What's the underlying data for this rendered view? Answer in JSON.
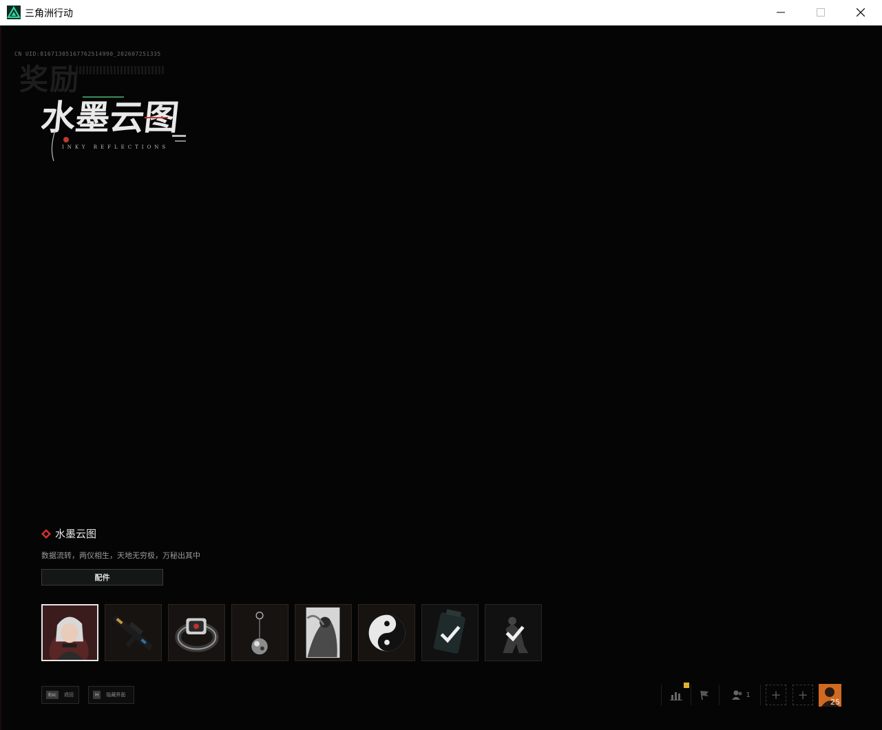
{
  "window": {
    "title": "三角洲行动",
    "icon": "delta-force-logo-icon",
    "controls": [
      "minimize-icon",
      "maximize-icon",
      "close-icon"
    ]
  },
  "page": {
    "uid": "CN UID:81671305167762514990_202607251335",
    "section_title": "奖励"
  },
  "collection": {
    "logo_text": "水墨云图",
    "logo_subtitle": "INKY REFLECTIONS",
    "name": "水墨云图",
    "description": "数据流转，两仪相生，天地无穷极，万秘出其中",
    "parts_button": "配件",
    "items": [
      {
        "icon": "operator-portrait-icon",
        "selected": true
      },
      {
        "icon": "rifle-skin-icon",
        "selected": false
      },
      {
        "icon": "bracelet-icon",
        "selected": false
      },
      {
        "icon": "pendant-charm-icon",
        "selected": false
      },
      {
        "icon": "card-art-icon",
        "selected": false
      },
      {
        "icon": "yin-yang-emblem-icon",
        "selected": false
      },
      {
        "icon": "device-checkmark-icon",
        "selected": false
      },
      {
        "icon": "pose-checkmark-icon",
        "selected": false
      }
    ]
  },
  "footer": {
    "hints": [
      {
        "key": "Esc",
        "label": "退回"
      },
      {
        "key": "H",
        "label": "隐藏界面"
      }
    ],
    "hud": {
      "party_count": "1",
      "level": "25"
    }
  },
  "colors": {
    "accent_red": "#d0342c",
    "selected_border": "#e6e6e6",
    "notification": "#e0b030"
  }
}
